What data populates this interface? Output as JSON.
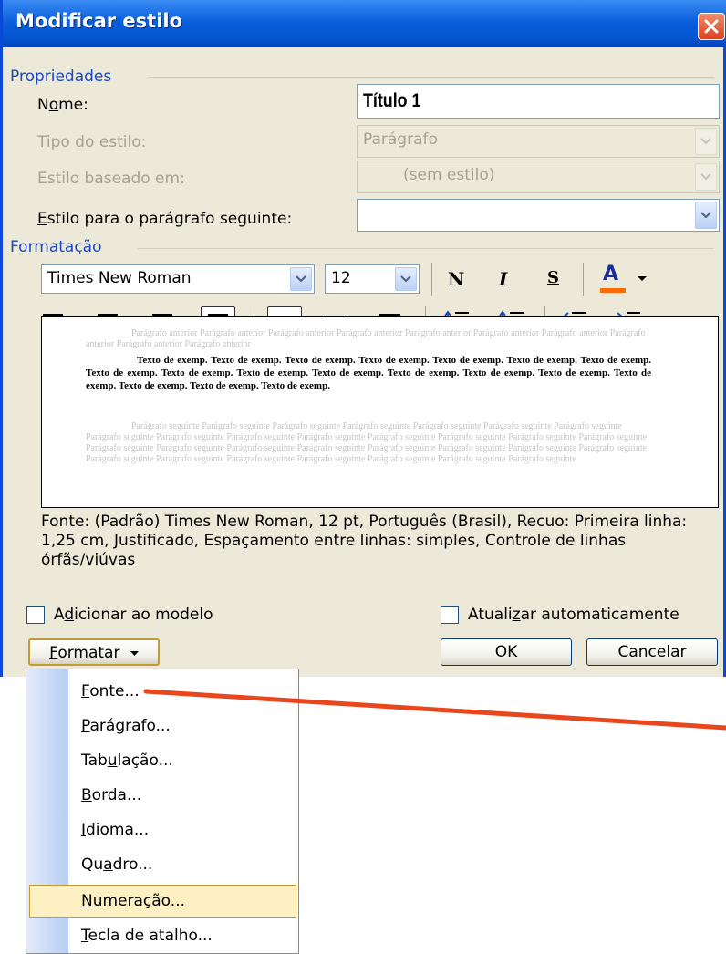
{
  "dialog": {
    "title": "Modificar estilo"
  },
  "properties": {
    "group_label": "Propriedades",
    "name_label_pre": "N",
    "name_label_ul": "o",
    "name_label_post": "me:",
    "name_value": "Título 1",
    "style_type_label": "Tipo do estilo:",
    "style_type_value": "Parágrafo",
    "based_on_label": "Estilo baseado em:",
    "based_on_value": "(sem estilo)",
    "next_style_label_ul": "E",
    "next_style_label_post": "stilo para o parágrafo seguinte:",
    "next_style_value": ""
  },
  "formatting": {
    "group_label": "Formatação",
    "font_value": "Times New Roman",
    "size_value": "12",
    "bold_label": "N",
    "italic_label": "I",
    "underline_label": "S",
    "font_color_label": "A",
    "font_color": "#ff6a00"
  },
  "preview": {
    "previous_text": "Parágrafo anterior Parágrafo anterior Parágrafo anterior Parágrafo anterior Parágrafo anterior Parágrafo anterior Parágrafo anterior Parágrafo anterior Parágrafo anterior Parágrafo anterior",
    "sample_text": "Texto de exemp. Texto de exemp. Texto de exemp. Texto de exemp. Texto de exemp. Texto de exemp. Texto de exemp. Texto de exemp. Texto de exemp. Texto de exemp. Texto de exemp. Texto de exemp. Texto de exemp. Texto de exemp. Texto de exemp. Texto de exemp. Texto de exemp. Texto de exemp.",
    "next_text": "Parágrafo seguinte Parágrafo seguinte Parágrafo seguinte Parágrafo seguinte Parágrafo seguinte Parágrafo seguinte Parágrafo seguinte Parágrafo seguinte Parágrafo seguinte Parágrafo seguinte Parágrafo seguinte Parágrafo seguinte Parágrafo seguinte Parágrafo seguinte Parágrafo seguinte Parágrafo seguinte Parágrafo seguinte Parágrafo seguinte Parágrafo seguinte Parágrafo seguinte Parágrafo seguinte Parágrafo seguinte Parágrafo seguinte Parágrafo seguinte Parágrafo seguinte Parágrafo seguinte Parágrafo seguinte Parágrafo seguinte Parágrafo seguinte Parágrafo seguinte"
  },
  "description": "Fonte: (Padrão) Times New Roman, 12 pt, Português (Brasil), Recuo: Primeira linha:  1,25 cm, Justificado, Espaçamento entre linhas:  simples, Controle de linhas órfãs/viúvas",
  "options": {
    "add_to_template_pre": "A",
    "add_to_template_ul": "d",
    "add_to_template_post": "icionar ao modelo",
    "auto_update_pre": "Atuali",
    "auto_update_ul": "z",
    "auto_update_post": "ar automaticamente"
  },
  "buttons": {
    "format_ul": "F",
    "format_post": "ormatar",
    "ok": "OK",
    "cancel": "Cancelar"
  },
  "menu": {
    "items": [
      {
        "ul": "F",
        "post": "onte..."
      },
      {
        "ul": "P",
        "post": "arágrafo..."
      },
      {
        "pre": "Tab",
        "ul": "u",
        "post": "lação..."
      },
      {
        "ul": "B",
        "post": "orda..."
      },
      {
        "ul": "I",
        "post": "dioma..."
      },
      {
        "pre": "Qu",
        "ul": "a",
        "post": "dro..."
      },
      {
        "ul": "N",
        "post": "umeração..."
      },
      {
        "ul": "T",
        "post": "ecla de atalho..."
      }
    ],
    "highlighted_index": 6
  },
  "colors": {
    "title_bar": "#0a5fdc",
    "group_label": "#1c47c4",
    "annotation_arrow": "#e8461c",
    "menu_highlight": "#fdf1c4"
  }
}
